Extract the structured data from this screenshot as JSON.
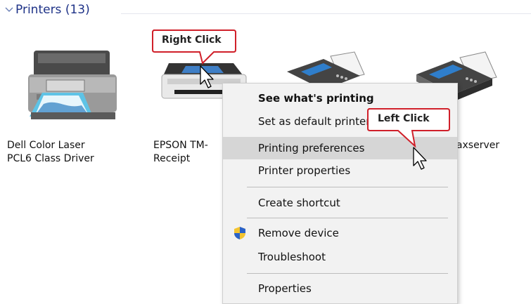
{
  "group": {
    "title": "Printers (13)",
    "chevron_icon": "chevron-down-icon"
  },
  "printers": [
    {
      "name_line1": "Dell Color Laser",
      "name_line2": "PCL6 Class Driver",
      "icon": "laser-printer-icon"
    },
    {
      "name_line1": "EPSON TM-",
      "name_line2": "Receipt",
      "icon": "receipt-printer-icon"
    },
    {
      "name_line1": "",
      "name_line2": "",
      "icon": "fax-icon"
    },
    {
      "name_line1": "faxserver",
      "name_line2": "",
      "icon": "fax-icon"
    }
  ],
  "context_menu": {
    "items": [
      {
        "label": "See what's printing",
        "bold": true
      },
      {
        "label": "Set as default printer"
      },
      {
        "label": "Printing preferences",
        "highlighted": true
      },
      {
        "label": "Printer properties"
      },
      {
        "label": "Create shortcut"
      },
      {
        "label": "Remove device",
        "icon": "uac-shield-icon"
      },
      {
        "label": "Troubleshoot"
      },
      {
        "label": "Properties"
      }
    ]
  },
  "callouts": {
    "right_click": "Right Click",
    "left_click": "Left Click"
  },
  "colors": {
    "group_title": "#1e3287",
    "menu_background": "#f2f2f2",
    "menu_highlight": "#d6d6d6",
    "callout_border": "#d0202a"
  }
}
